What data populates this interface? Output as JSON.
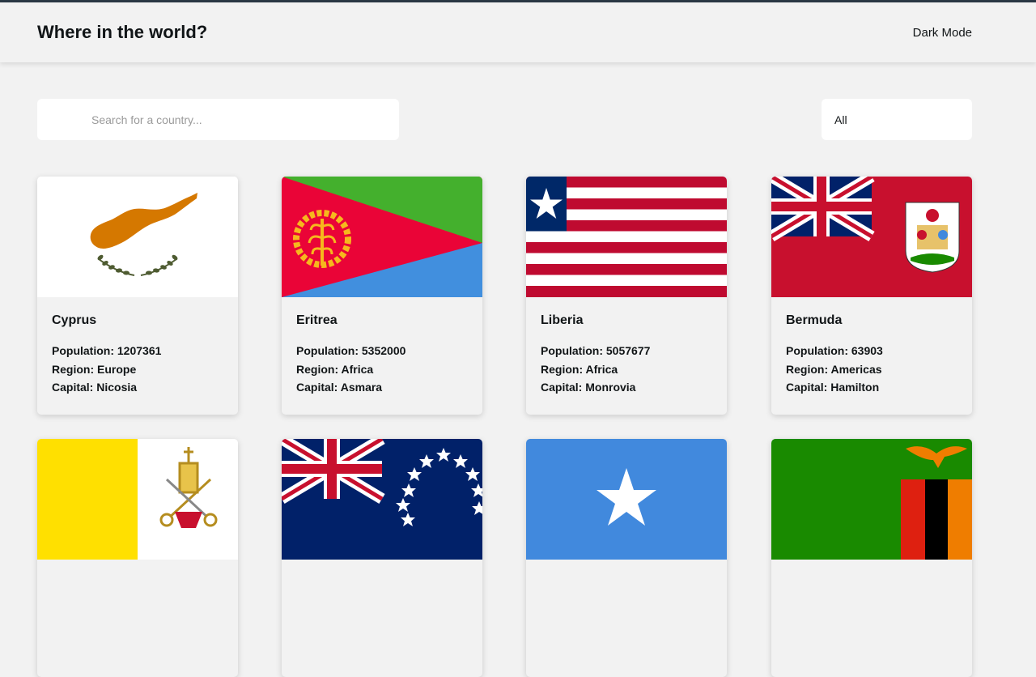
{
  "header": {
    "title": "Where in the world?",
    "mode_label": "Dark Mode"
  },
  "search": {
    "placeholder": "Search for a country..."
  },
  "filter": {
    "selected": "All"
  },
  "labels": {
    "population": "Population: ",
    "region": "Region: ",
    "capital": "Capital: "
  },
  "countries": [
    {
      "name": "Cyprus",
      "population": "1207361",
      "region": "Europe",
      "capital": "Nicosia"
    },
    {
      "name": "Eritrea",
      "population": "5352000",
      "region": "Africa",
      "capital": "Asmara"
    },
    {
      "name": "Liberia",
      "population": "5057677",
      "region": "Africa",
      "capital": "Monrovia"
    },
    {
      "name": "Bermuda",
      "population": "63903",
      "region": "Americas",
      "capital": "Hamilton"
    }
  ],
  "colors": {
    "background": "#f2f2f2",
    "text": "#111517",
    "topline": "#2b3945",
    "eritrea_green": "#44b02d",
    "eritrea_red": "#ea0437",
    "eritrea_blue": "#418fde",
    "eritrea_gold": "#f6b81d",
    "liberia_red": "#bf0a30",
    "liberia_blue": "#002868",
    "bermuda_red": "#c8102e",
    "uk_blue": "#012169",
    "cyprus_copper": "#d57800",
    "cyprus_olive": "#4e5b31",
    "vatican_yellow": "#ffe000",
    "somalia_blue": "#4189dd",
    "zambia_green": "#198a00",
    "zambia_orange": "#ef7d00"
  }
}
